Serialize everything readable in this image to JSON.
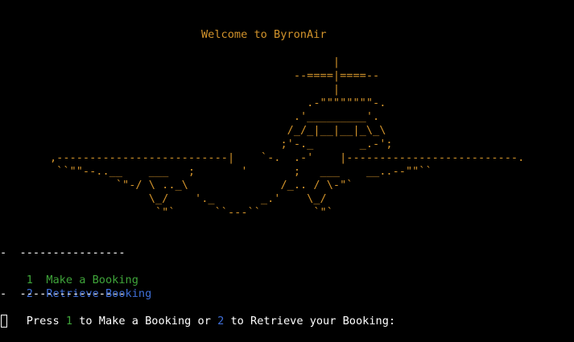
{
  "colors": {
    "background": "#000000",
    "banner": "#d2932b",
    "menu_text": "#ffffff",
    "option_make": "#3fa43a",
    "option_retrieve": "#3f6fd8",
    "prompt_text": "#ffffff"
  },
  "banner": {
    "welcome": "Welcome to ByronAir",
    "airplane_lines": [
      "                                           |",
      "                                     --====|====--",
      "                                           |",
      "                                       .-\"\"\"\"\"\"\"\"-.",
      "                                     .'_________'.",
      "                                    /_/_|__|__|_\\_\\",
      "                                   ;'-._       _.-';",
      ",--------------------------|    `-.  .-'    |--------------------------.",
      " ``\"\"--..__    ___   ;       '       ;   ___    __..--\"\"``",
      "          `\"-/ \\ .._\\              /_.. / \\-\"`",
      "               \\_/    '._       _.'    \\_/",
      "                `\"`      ``---``        `\"`"
    ]
  },
  "menu": {
    "divider_top": "-  ----------------",
    "options": [
      {
        "key": "1",
        "label": "Make a Booking"
      },
      {
        "key": "2",
        "label": "Retrieve Booking"
      }
    ],
    "divider_bottom": "-  ----------------"
  },
  "prompt": {
    "part1": "Press ",
    "key1": "1",
    "part2": " to Make a Booking or ",
    "key2": "2",
    "part3": " to Retrieve your Booking:"
  },
  "cursor": {
    "icon": "block-cursor"
  }
}
